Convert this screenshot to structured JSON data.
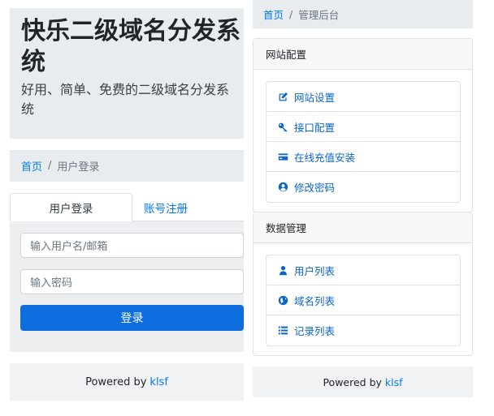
{
  "jumbotron": {
    "title": "快乐二级域名分发系统",
    "subtitle": "好用、简单、免费的二级域名分发系统"
  },
  "left": {
    "breadcrumb": {
      "home": "首页",
      "separator": "/",
      "current": "用户登录"
    },
    "tabs": {
      "login": "用户登录",
      "register": "账号注册"
    },
    "form": {
      "username_placeholder": "输入用户名/邮箱",
      "password_placeholder": "输入密码",
      "submit_label": "登录"
    },
    "footer": {
      "text": "Powered by",
      "link": "klsf"
    }
  },
  "right": {
    "breadcrumb": {
      "home": "首页",
      "separator": "/",
      "current": "管理后台"
    },
    "site_config": {
      "header": "网站配置",
      "items": [
        {
          "label": "网站设置",
          "icon": "edit-icon"
        },
        {
          "label": "接口配置",
          "icon": "key-icon"
        },
        {
          "label": "在线充值安装",
          "icon": "credit-card-icon"
        },
        {
          "label": "修改密码",
          "icon": "user-circle-icon"
        }
      ]
    },
    "data_mgmt": {
      "header": "数据管理",
      "items": [
        {
          "label": "用户列表",
          "icon": "user-icon"
        },
        {
          "label": "域名列表",
          "icon": "globe-icon"
        },
        {
          "label": "记录列表",
          "icon": "list-icon"
        }
      ]
    },
    "footer": {
      "text": "Powered by",
      "link": "klsf"
    }
  },
  "colors": {
    "primary": "#007bff",
    "button": "#0d6fdf",
    "panel": "#e9ecef"
  }
}
